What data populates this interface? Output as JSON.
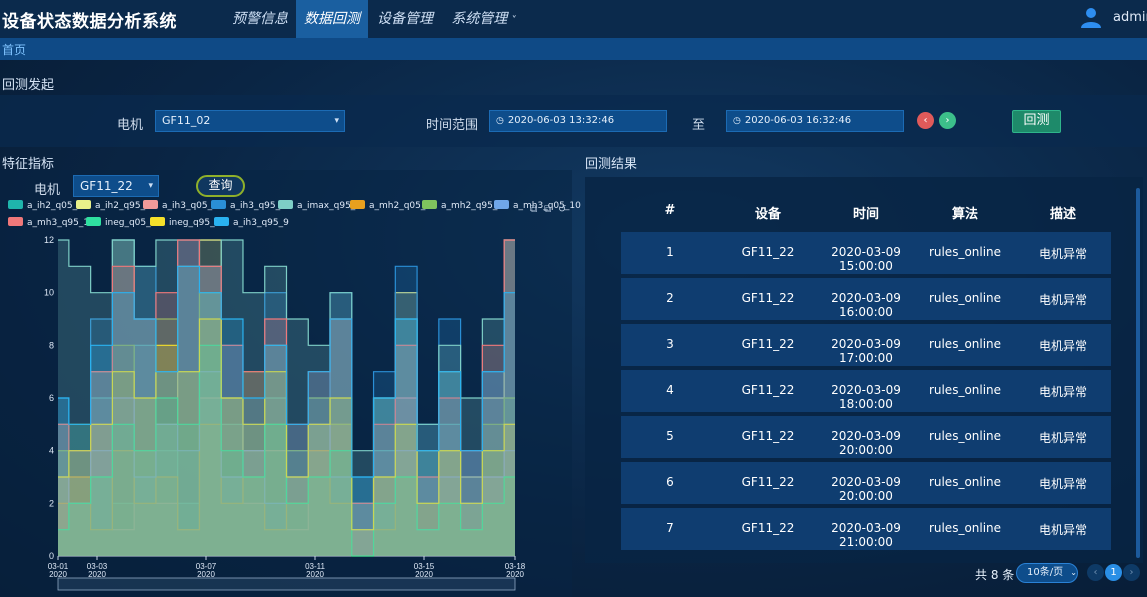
{
  "header": {
    "app_title": "设备状态数据分析系统",
    "nav": [
      {
        "label": "预警信息"
      },
      {
        "label": "数据回测"
      },
      {
        "label": "设备管理"
      },
      {
        "label": "系统管理",
        "caret": "˅"
      }
    ],
    "username": "admin"
  },
  "breadcrumb": "首页",
  "backtest": {
    "section_title": "回测发起",
    "motor_label": "电机",
    "motor_value": "GF11_02",
    "time_range_label": "时间范围",
    "start_time": "2020-06-03 13:32:46",
    "to_label": "至",
    "end_time": "2020-06-03 16:32:46",
    "submit_label": "回测"
  },
  "features": {
    "section_title": "特征指标",
    "motor_label": "电机",
    "motor_value": "GF11_22",
    "query_label": "查询"
  },
  "results": {
    "section_title": "回测结果",
    "columns": [
      "#",
      "设备",
      "时间",
      "算法",
      "描述"
    ],
    "rows": [
      [
        "1",
        "GF11_22",
        "2020-03-09 15:00:00",
        "rules_online",
        "电机异常"
      ],
      [
        "2",
        "GF11_22",
        "2020-03-09 16:00:00",
        "rules_online",
        "电机异常"
      ],
      [
        "3",
        "GF11_22",
        "2020-03-09 17:00:00",
        "rules_online",
        "电机异常"
      ],
      [
        "4",
        "GF11_22",
        "2020-03-09 18:00:00",
        "rules_online",
        "电机异常"
      ],
      [
        "5",
        "GF11_22",
        "2020-03-09 20:00:00",
        "rules_online",
        "电机异常"
      ],
      [
        "6",
        "GF11_22",
        "2020-03-09 20:00:00",
        "rules_online",
        "电机异常"
      ],
      [
        "7",
        "GF11_22",
        "2020-03-09 21:00:00",
        "rules_online",
        "电机异常"
      ]
    ],
    "pager_total": "共 8 条",
    "pager_size": "10条/页",
    "current_page": "1"
  },
  "chart_data": {
    "type": "area",
    "x": [
      "03-01",
      "03-03",
      "03-07",
      "03-11",
      "03-15",
      "03-18"
    ],
    "x_year": "2020",
    "y_ticks": [
      "0",
      "2",
      "4",
      "6",
      "8",
      "10",
      "12"
    ],
    "ylim": [
      0,
      12
    ],
    "legend_position": "top",
    "series": [
      {
        "name": "a_ih2_q05_1",
        "color": "#1fb5ac",
        "values": [
          4,
          2,
          6,
          2,
          8,
          4,
          2,
          10,
          5,
          3,
          6,
          2,
          4,
          6,
          2,
          4,
          8,
          3,
          5,
          2,
          4,
          6
        ]
      },
      {
        "name": "a_ih2_q95_1",
        "color": "#e8f08a",
        "values": [
          5,
          3,
          7,
          12,
          9,
          5,
          11,
          12,
          6,
          4,
          8,
          3,
          5,
          9,
          2,
          6,
          10,
          4,
          7,
          3,
          6,
          12
        ]
      },
      {
        "name": "a_ih3_q05_4",
        "color": "#f09a9a",
        "values": [
          3,
          2,
          5,
          1,
          4,
          2,
          1,
          6,
          3,
          2,
          4,
          1,
          3,
          5,
          1,
          3,
          6,
          2,
          4,
          1,
          3,
          5
        ]
      },
      {
        "name": "a_ih3_q95_4",
        "color": "#2a8fd6",
        "values": [
          6,
          4,
          9,
          12,
          11,
          7,
          12,
          11,
          8,
          5,
          10,
          4,
          6,
          10,
          3,
          7,
          11,
          5,
          9,
          4,
          7,
          12
        ]
      },
      {
        "name": "a_imax_q95_7",
        "color": "#7ecfc7",
        "values": [
          12,
          11,
          10,
          12,
          11,
          12,
          12,
          11,
          12,
          10,
          11,
          9,
          8,
          10,
          4,
          6,
          9,
          5,
          8,
          6,
          9,
          12
        ]
      },
      {
        "name": "a_mh2_q05_5",
        "color": "#e8a01e",
        "values": [
          2,
          3,
          1,
          4,
          2,
          3,
          1,
          5,
          2,
          3,
          1,
          2,
          4,
          2,
          0,
          1,
          3,
          1,
          2,
          1,
          2,
          3
        ]
      },
      {
        "name": "a_mh2_q95_5",
        "color": "#7fc35e",
        "values": [
          4,
          5,
          3,
          8,
          6,
          9,
          7,
          10,
          6,
          7,
          5,
          4,
          6,
          5,
          1,
          3,
          5,
          2,
          4,
          2,
          5,
          6
        ]
      },
      {
        "name": "a_mh3_q05_10",
        "color": "#6fa6e8",
        "values": [
          3,
          2,
          4,
          6,
          3,
          5,
          4,
          7,
          3,
          4,
          2,
          3,
          5,
          3,
          1,
          2,
          4,
          1,
          3,
          2,
          3,
          4
        ]
      },
      {
        "name": "a_mh3_q95_10",
        "color": "#f0787a",
        "values": [
          5,
          4,
          7,
          11,
          9,
          10,
          12,
          11,
          8,
          7,
          9,
          5,
          7,
          9,
          2,
          5,
          8,
          3,
          6,
          4,
          8,
          12
        ]
      },
      {
        "name": "ineg_q05_4",
        "color": "#2fe0a0",
        "values": [
          1,
          2,
          3,
          5,
          4,
          6,
          5,
          8,
          4,
          3,
          5,
          2,
          3,
          4,
          0,
          2,
          3,
          1,
          2,
          1,
          2,
          3
        ]
      },
      {
        "name": "ineg_q95_4",
        "color": "#f5e02a",
        "values": [
          3,
          4,
          5,
          7,
          6,
          8,
          7,
          9,
          6,
          5,
          7,
          3,
          5,
          6,
          1,
          3,
          5,
          2,
          4,
          2,
          4,
          5
        ]
      },
      {
        "name": "a_ih3_q95_9",
        "color": "#2ab2f0",
        "values": [
          6,
          5,
          8,
          10,
          9,
          7,
          11,
          10,
          9,
          6,
          8,
          5,
          7,
          9,
          3,
          6,
          9,
          4,
          7,
          4,
          7,
          10
        ]
      }
    ]
  }
}
